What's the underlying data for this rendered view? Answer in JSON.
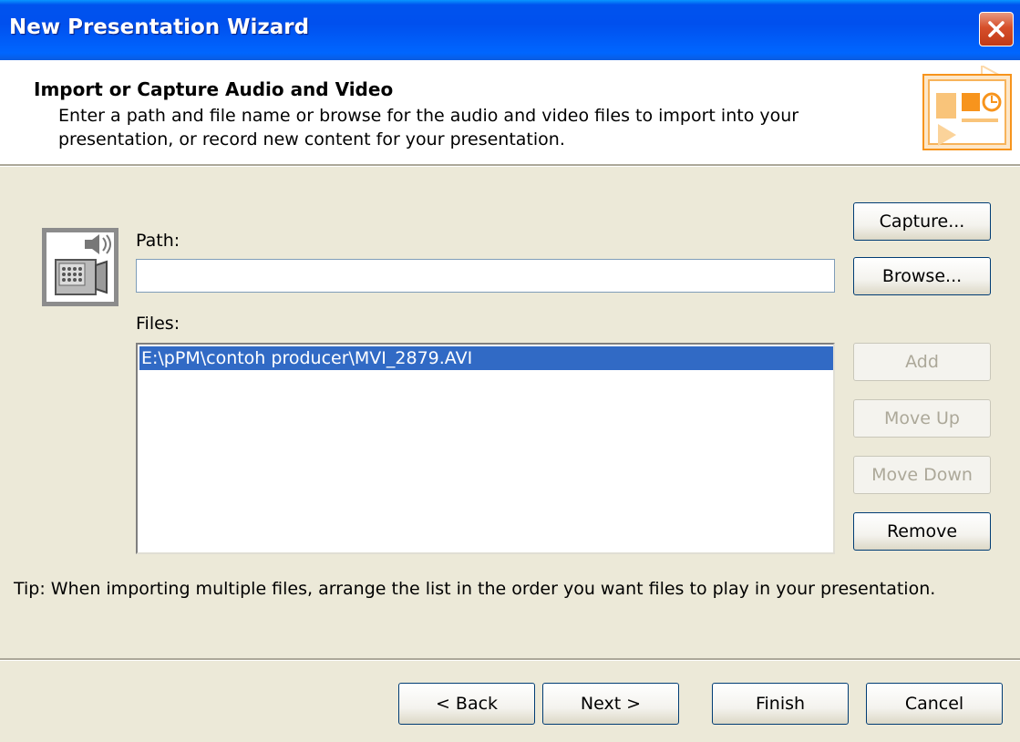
{
  "window": {
    "title": "New Presentation Wizard",
    "close_icon": "close-icon"
  },
  "header": {
    "title": "Import or Capture Audio and Video",
    "description": "Enter a path and file name or browse for the audio and video files to import into your presentation, or record new content for your presentation.",
    "icon": "presentation-wizard-icon"
  },
  "media_icon": "camcorder-icon",
  "path": {
    "label": "Path:",
    "value": "",
    "placeholder": ""
  },
  "files": {
    "label": "Files:",
    "items": [
      "E:\\pPM\\contoh producer\\MVI_2879.AVI"
    ],
    "selected_index": 0
  },
  "buttons": {
    "capture": "Capture...",
    "browse": "Browse...",
    "add": "Add",
    "move_up": "Move Up",
    "move_down": "Move Down",
    "remove": "Remove"
  },
  "tip": "Tip: When importing multiple files, arrange the list in the order you want files to play in your presentation.",
  "footer": {
    "back": "< Back",
    "next": "Next >",
    "finish": "Finish",
    "cancel": "Cancel"
  },
  "colors": {
    "titlebar": "#0053ee",
    "dialog_bg": "#ece9d8",
    "selection": "#316ac5",
    "accent_orange": "#f7941d"
  }
}
